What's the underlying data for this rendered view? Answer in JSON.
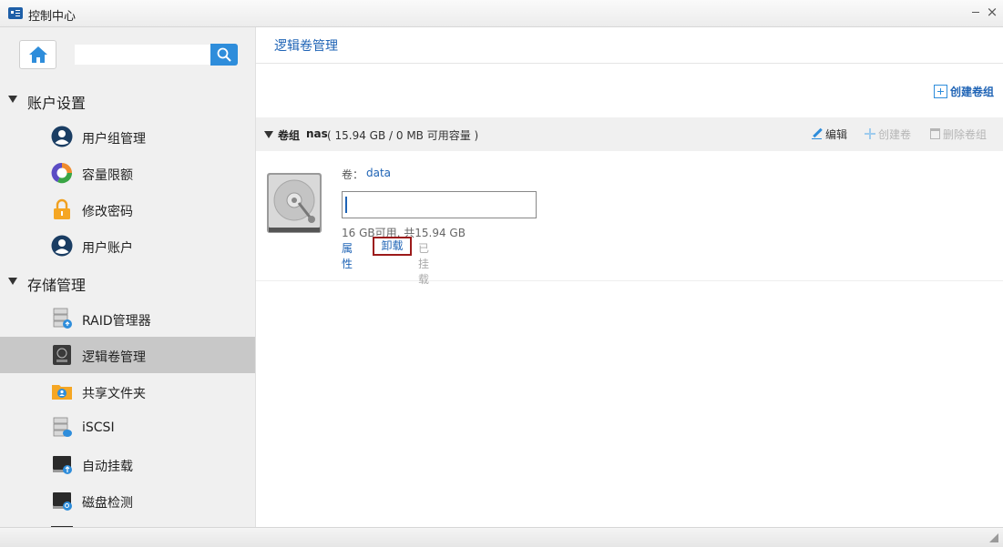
{
  "window": {
    "title": "控制中心",
    "minimize_icon": "minimize-icon",
    "close_icon": "close-icon"
  },
  "sidebar": {
    "search": {
      "value": "",
      "placeholder": ""
    },
    "sections": [
      {
        "label": "账户设置",
        "items": [
          {
            "label": "用户组管理",
            "icon": "user-group-icon"
          },
          {
            "label": "容量限额",
            "icon": "quota-pie-icon"
          },
          {
            "label": "修改密码",
            "icon": "lock-icon"
          },
          {
            "label": "用户账户",
            "icon": "user-account-icon"
          }
        ]
      },
      {
        "label": "存储管理",
        "items": [
          {
            "label": "RAID管理器",
            "icon": "raid-icon"
          },
          {
            "label": "逻辑卷管理",
            "icon": "lvm-icon",
            "selected": true
          },
          {
            "label": "共享文件夹",
            "icon": "shared-folder-icon"
          },
          {
            "label": "iSCSI",
            "icon": "iscsi-icon"
          },
          {
            "label": "自动挂载",
            "icon": "automount-icon"
          },
          {
            "label": "磁盘检测",
            "icon": "disk-check-icon"
          }
        ]
      }
    ]
  },
  "main": {
    "page_title": "逻辑卷管理",
    "create_volume_group_label": "创建卷组",
    "volume_group": {
      "label": "卷组",
      "name": "nas",
      "capacity_text": "( 15.94 GB / 0 MB 可用容量 )",
      "edit_label": "编辑",
      "create_volume_label": "创建卷",
      "delete_group_label": "删除卷组"
    },
    "volume": {
      "label": "卷：",
      "name": "data",
      "input_value": "",
      "capacity_text": "16 GB可用, 共15.94 GB",
      "properties_label": "属性",
      "unmount_label": "卸载",
      "mounted_label": "已挂载"
    }
  },
  "colors": {
    "accent": "#1e63b5",
    "search_button": "#2e8ddb",
    "selected_row": "#c8c8c8",
    "highlight_box": "#9c1a1a"
  }
}
